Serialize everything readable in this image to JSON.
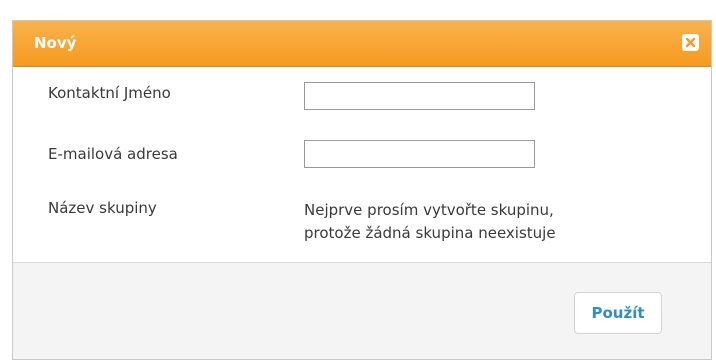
{
  "dialog": {
    "title": "Nový",
    "close_icon": "close-icon",
    "accent_color": "#f7a22e"
  },
  "form": {
    "contact_name_label": "Kontaktní Jméno",
    "contact_name_value": "",
    "email_label": "E-mailová adresa",
    "email_value": "",
    "group_label": "Název skupiny",
    "group_note_line1": "Nejprve prosím vytvořte skupinu,",
    "group_note_line2": "protože žádná skupina neexistuje"
  },
  "footer": {
    "apply_label": "Použít"
  }
}
